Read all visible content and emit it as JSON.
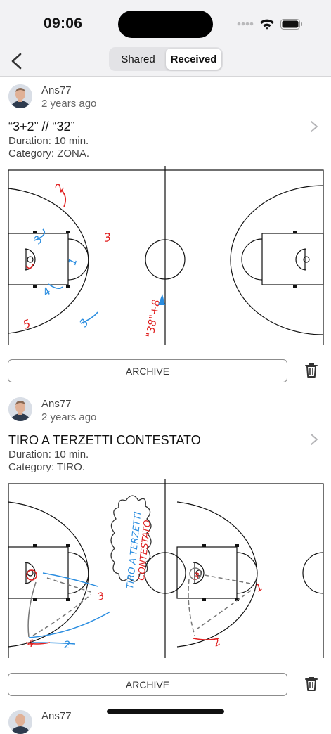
{
  "status_bar": {
    "time": "09:06"
  },
  "nav": {
    "tabs": [
      {
        "label": "Shared"
      },
      {
        "label": "Received"
      }
    ],
    "active_tab": "Received"
  },
  "posts": [
    {
      "user": "Ans77",
      "time_ago": "2 years ago",
      "title": "“3+2” // “32”",
      "duration": "Duration: 10 min.",
      "category": "Category: ZONA.",
      "archive_label": "ARCHIVE"
    },
    {
      "user": "Ans77",
      "time_ago": "2 years ago",
      "title": "TIRO A TERZETTI CONTESTATO",
      "duration": "Duration: 10 min.",
      "category": "Category: TIRO.",
      "archive_label": "ARCHIVE"
    },
    {
      "user": "Ans77"
    }
  ],
  "diagram1": {
    "annotations": [
      "2",
      "3",
      "5",
      "3",
      "4",
      "1",
      "5",
      "3",
      "\"38\"+8"
    ]
  },
  "diagram2": {
    "annotations": [
      "TIRO A TERZETTI",
      "CONTESTATO",
      "3",
      "4",
      "2",
      "3",
      "1",
      "2"
    ]
  },
  "colors": {
    "red": "#e02020",
    "blue": "#2a8de0",
    "gray": "#777777"
  }
}
